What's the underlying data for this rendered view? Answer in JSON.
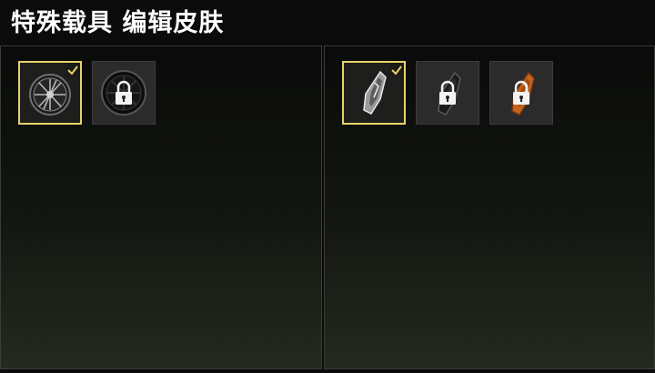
{
  "header": {
    "title": "特殊载具 编辑皮肤"
  },
  "panels": [
    {
      "id": "wheels",
      "items": [
        {
          "icon": "rim-wheel-icon",
          "selected": true,
          "locked": false
        },
        {
          "icon": "black-wheel-icon",
          "selected": false,
          "locked": true
        }
      ]
    },
    {
      "id": "body",
      "items": [
        {
          "icon": "silver-vehicle-skin-icon",
          "selected": true,
          "locked": false
        },
        {
          "icon": "dark-vehicle-skin-icon",
          "selected": false,
          "locked": true
        },
        {
          "icon": "orange-vehicle-skin-icon",
          "selected": false,
          "locked": true
        }
      ]
    }
  ],
  "colors": {
    "selected_border": "#e6d36a",
    "check": "#e6d36a",
    "orange_skin": "#c8641e"
  }
}
